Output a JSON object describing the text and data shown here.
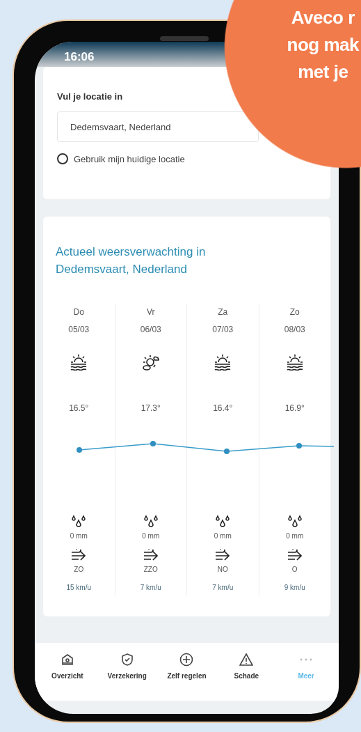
{
  "status_bar": {
    "time": "16:06"
  },
  "location": {
    "label": "Vul je locatie in",
    "value": "Dedemsvaart, Nederland",
    "use_current": {
      "label": "Gebruik mijn huidige locatie",
      "checked": false
    }
  },
  "forecast": {
    "title": "Actueel weersverwachting in Dedemsvaart, Nederland",
    "days": [
      {
        "day": "Do",
        "date": "05/03",
        "kind": "haze",
        "temperature": "16.5°",
        "rain": "0 mm",
        "wind_direction": "ZO",
        "wind_speed": "15 km/u"
      },
      {
        "day": "Vr",
        "date": "06/03",
        "kind": "partly-cloudy",
        "temperature": "17.3°",
        "rain": "0 mm",
        "wind_direction": "ZZO",
        "wind_speed": "7 km/u"
      },
      {
        "day": "Za",
        "date": "07/03",
        "kind": "haze",
        "temperature": "16.4°",
        "rain": "0 mm",
        "wind_direction": "NO",
        "wind_speed": "7 km/u"
      },
      {
        "day": "Zo",
        "date": "08/03",
        "kind": "haze",
        "temperature": "16.9°",
        "rain": "0 mm",
        "wind_direction": "O",
        "wind_speed": "9 km/u"
      }
    ]
  },
  "nav": [
    {
      "label": "Overzicht",
      "kind": "home",
      "selected": false
    },
    {
      "label": "Verzekering",
      "kind": "shield",
      "selected": false
    },
    {
      "label": "Zelf regelen",
      "kind": "plus",
      "selected": false
    },
    {
      "label": "Schade",
      "kind": "warning",
      "selected": false
    },
    {
      "label": "Meer",
      "kind": "more",
      "selected": true
    }
  ],
  "promo_badge": {
    "lines": [
      "Aveco r",
      "nog mak",
      "met je"
    ]
  }
}
